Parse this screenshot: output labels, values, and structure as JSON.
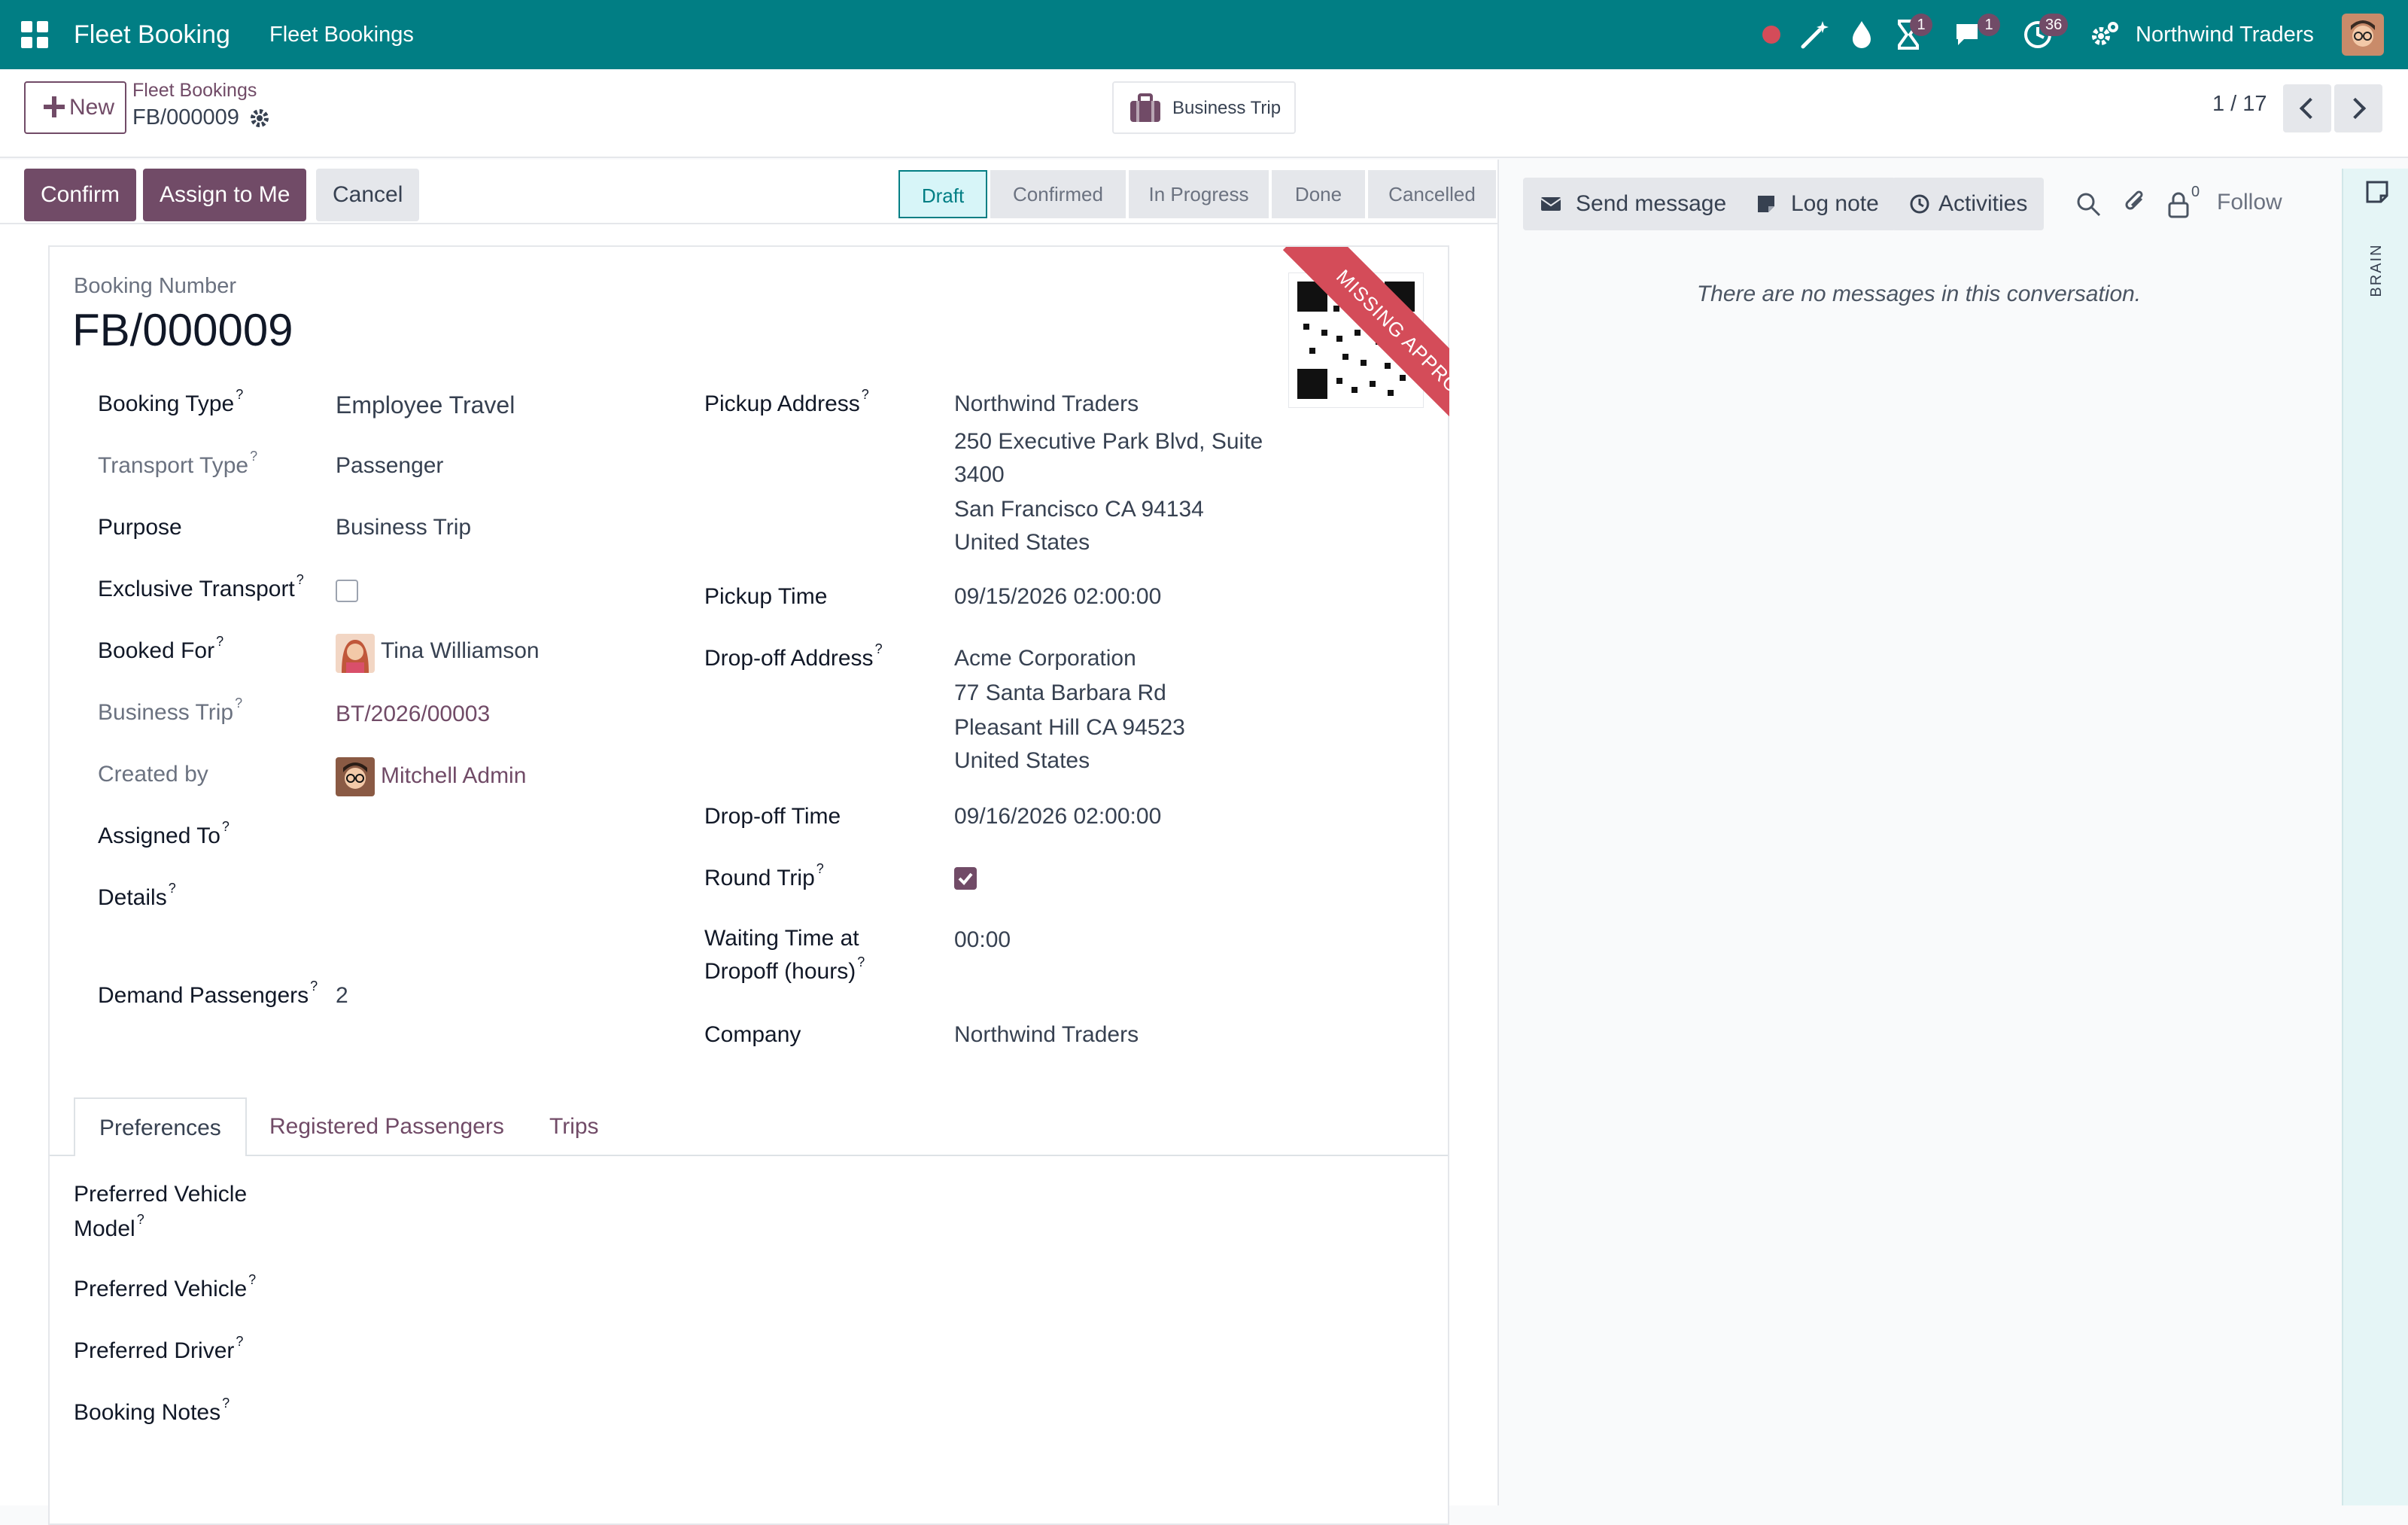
{
  "navbar": {
    "app_name": "Fleet Booking",
    "menu_item": "Fleet Bookings",
    "company": "Northwind Traders",
    "badges": {
      "activities": "1",
      "messages": "1",
      "clock": "36"
    }
  },
  "control_panel": {
    "new_label": "New",
    "breadcrumb_parent": "Fleet Bookings",
    "record_name": "FB/000009",
    "smart_button_label": "Business Trip",
    "pager": "1 / 17"
  },
  "statusbar": {
    "buttons": {
      "confirm": "Confirm",
      "assign": "Assign to Me",
      "cancel": "Cancel"
    },
    "stages": [
      "Draft",
      "Confirmed",
      "In Progress",
      "Done",
      "Cancelled"
    ],
    "active_stage": "Draft"
  },
  "form": {
    "ribbon": "MISSING APPROVAL",
    "booking_number_label": "Booking Number",
    "booking_number": "FB/000009",
    "left": {
      "booking_type": {
        "label": "Booking Type",
        "value": "Employee Travel"
      },
      "transport_type": {
        "label": "Transport Type",
        "value": "Passenger"
      },
      "purpose": {
        "label": "Purpose",
        "value": "Business Trip"
      },
      "exclusive_transport": {
        "label": "Exclusive Transport",
        "checked": false
      },
      "booked_for": {
        "label": "Booked For",
        "value": "Tina Williamson"
      },
      "business_trip": {
        "label": "Business Trip",
        "value": "BT/2026/00003"
      },
      "created_by": {
        "label": "Created by",
        "value": "Mitchell Admin"
      },
      "assigned_to": {
        "label": "Assigned To",
        "value": ""
      },
      "details": {
        "label": "Details",
        "value": ""
      },
      "demand_passengers": {
        "label": "Demand Passengers",
        "value": "2"
      }
    },
    "right": {
      "pickup_address": {
        "label": "Pickup Address",
        "lines": [
          "Northwind Traders",
          "250 Executive Park Blvd, Suite",
          "3400",
          "San Francisco CA 94134",
          "United States"
        ]
      },
      "pickup_time": {
        "label": "Pickup Time",
        "value": "09/15/2026 02:00:00"
      },
      "dropoff_address": {
        "label": "Drop-off Address",
        "lines": [
          "Acme Corporation",
          "77 Santa Barbara Rd",
          "Pleasant Hill CA 94523",
          "United States"
        ]
      },
      "dropoff_time": {
        "label": "Drop-off Time",
        "value": "09/16/2026 02:00:00"
      },
      "round_trip": {
        "label": "Round Trip",
        "checked": true
      },
      "waiting_time": {
        "label_line1": "Waiting Time at",
        "label_line2": "Dropoff (hours)",
        "value": "00:00"
      },
      "company": {
        "label": "Company",
        "value": "Northwind Traders"
      }
    },
    "tabs": [
      "Preferences",
      "Registered Passengers",
      "Trips"
    ],
    "preferences": {
      "vehicle_model_line1": "Preferred Vehicle",
      "vehicle_model_line2": "Model",
      "vehicle": "Preferred Vehicle",
      "driver": "Preferred Driver",
      "notes": "Booking Notes"
    }
  },
  "chatter": {
    "send_message": "Send message",
    "log_note": "Log note",
    "activities": "Activities",
    "followers_count": "0",
    "follow": "Follow",
    "empty_message": "There are no messages in this conversation."
  },
  "side_panel": {
    "label": "BRAIN"
  }
}
